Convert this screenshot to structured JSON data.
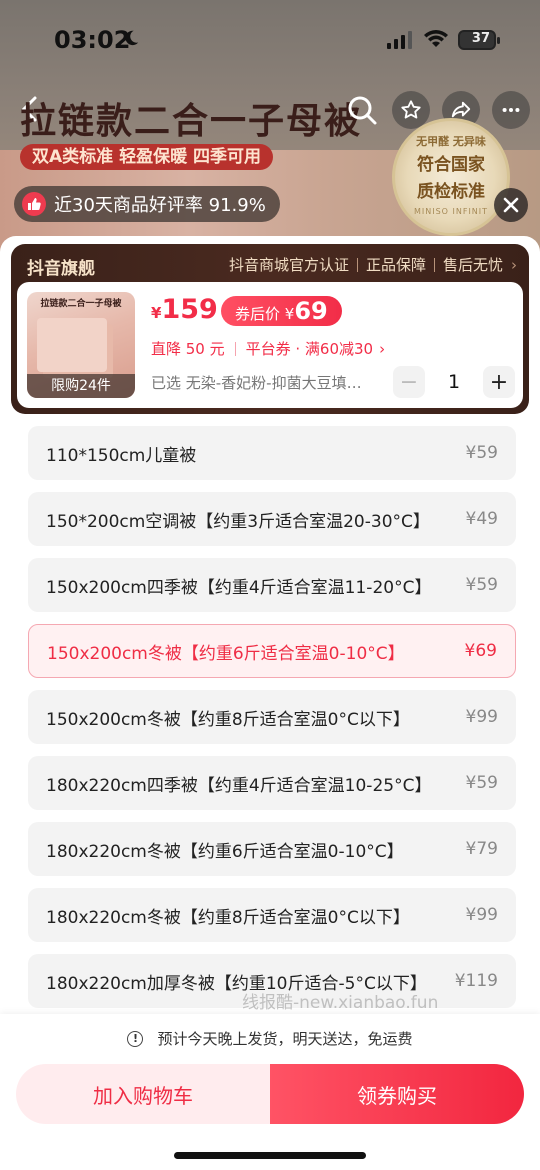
{
  "status_bar": {
    "time": "03:02",
    "battery": "37"
  },
  "banner": {
    "title": "拉链款二合一子母被",
    "subtitle": "双A类标准 轻盈保暖 四季可用",
    "cert_top": "无甲醛 无异味",
    "cert_main_1": "符合国家",
    "cert_main_2": "质检标准",
    "cert_bottom": "MINISO INFINIT"
  },
  "rating": {
    "text": "近30天商品好评率 91.9%"
  },
  "store": {
    "name": "抖音旗舰",
    "badges": [
      "抖音商城官方认证",
      "正品保障",
      "售后无忧"
    ]
  },
  "product": {
    "thumb_title": "拉链款二合一子母被",
    "limit": "限购24件",
    "currency": "¥",
    "price": "159",
    "coupon_label": "券后价 ¥",
    "coupon_price": "69",
    "discount": "直降 50 元",
    "platform_coupon": "平台券 · 满60减30",
    "selected": "已选 无染-香妃粉-抑菌大豆填…",
    "quantity": "1",
    "minus": "−",
    "plus": "+"
  },
  "options": [
    {
      "label": "110*150cm儿童被",
      "price": "¥59",
      "selected": false
    },
    {
      "label": "150*200cm空调被【约重3斤适合室温20-30°C】",
      "price": "¥49",
      "selected": false
    },
    {
      "label": "150x200cm四季被【约重4斤适合室温11-20°C】",
      "price": "¥59",
      "selected": false
    },
    {
      "label": "150x200cm冬被【约重6斤适合室温0-10°C】",
      "price": "¥69",
      "selected": true
    },
    {
      "label": "150x200cm冬被【约重8斤适合室温0°C以下】",
      "price": "¥99",
      "selected": false
    },
    {
      "label": "180x220cm四季被【约重4斤适合室温10-25°C】",
      "price": "¥59",
      "selected": false
    },
    {
      "label": "180x220cm冬被【约重6斤适合室温0-10°C】",
      "price": "¥79",
      "selected": false
    },
    {
      "label": "180x220cm冬被【约重8斤适合室温0°C以下】",
      "price": "¥99",
      "selected": false
    },
    {
      "label": "180x220cm加厚冬被【约重10斤适合-5°C以下】",
      "price": "¥119",
      "selected": false
    }
  ],
  "watermark": "线报酷-new.xianbao.fun",
  "footer": {
    "shipping_note": "预计今天晚上发货，明天送达，免运费",
    "add_to_cart": "加入购物车",
    "buy_with_coupon": "领券购买"
  },
  "colors": {
    "accent": "#f22d48",
    "store_bg": "#3a2119"
  }
}
